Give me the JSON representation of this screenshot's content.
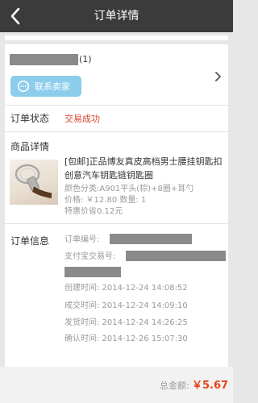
{
  "header": {
    "title": "订单详情",
    "back_icon": "chevron-left-icon"
  },
  "seller": {
    "count": "(1)",
    "contact_label": "联系卖家",
    "contact_icon": "chat-bubble-icon"
  },
  "status": {
    "label": "订单状态",
    "value": "交易成功",
    "value_color": "#d8442a"
  },
  "product": {
    "section_label": "商品详情",
    "title": "[包邮]正品博友真皮高档男士腰挂钥匙扣 创意汽车钥匙链钥匙圈",
    "color_category": "颜色分类:A901平头(棕)+8圈+耳勺",
    "price_qty": "价格: ￥12.80   数量: 1",
    "special_price": "特惠价省0.12元"
  },
  "order_info": {
    "section_label": "订单信息",
    "order_no_label": "订单编号:",
    "alipay_no_label": "支付宝交易号:",
    "created": "创建时间:  2014-12-24 14:08:52",
    "deal": "成交时间:  2014-12-24 14:09:10",
    "shipped": "发货时间:  2014-12-24 14:26:25",
    "confirmed": "确认时间:  2014-12-26 15:07:30"
  },
  "footer": {
    "total_label": "总金额:",
    "total_value": "￥5.67",
    "total_color": "#e7431a"
  }
}
